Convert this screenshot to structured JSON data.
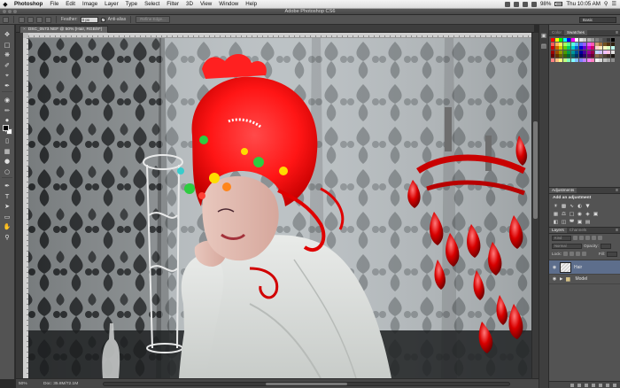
{
  "menubar": {
    "apple_glyph": "",
    "items": [
      "Photoshop",
      "File",
      "Edit",
      "Image",
      "Layer",
      "Type",
      "Select",
      "Filter",
      "3D",
      "View",
      "Window",
      "Help"
    ],
    "battery": "98%",
    "clock": "Thu 10:05 AM"
  },
  "window": {
    "title": "Adobe Photoshop CS6"
  },
  "options": {
    "feather_label": "Feather:",
    "feather_value": "0 px",
    "anti_alias_label": "Anti-alias",
    "refine_label": "Refine Edge...",
    "workspace_value": "Basic"
  },
  "document": {
    "tab_title": "DSC_0573.NEF @ 50% (Hair, RGB/8*)",
    "zoom": "50%",
    "doc_size": "Doc: 35.8M/72.1M"
  },
  "panels": {
    "color_tabs": [
      "Color",
      "Swatches"
    ],
    "swatch_colors": [
      "#ff0000",
      "#ffff00",
      "#00ff00",
      "#00ffff",
      "#0000ff",
      "#ff00ff",
      "#ffffff",
      "#e6e6e6",
      "#cccccc",
      "#b3b3b3",
      "#999999",
      "#808080",
      "#666666",
      "#4d4d4d",
      "#333333",
      "#000000",
      "#ff5a5a",
      "#ffb35a",
      "#fff05a",
      "#a8ff5a",
      "#5aff8d",
      "#5affe0",
      "#5ab8ff",
      "#5a6bff",
      "#9a5aff",
      "#e85aff",
      "#ff5ab0",
      "#c8a070",
      "#a07040",
      "#705020",
      "#503010",
      "#302010",
      "#cc0000",
      "#cc6600",
      "#cccc00",
      "#66cc00",
      "#00cc66",
      "#00cccc",
      "#0066cc",
      "#0000cc",
      "#6600cc",
      "#cc00cc",
      "#cc0066",
      "#ffd0d0",
      "#ffe8c0",
      "#fff8c0",
      "#d8ffc0",
      "#c0fff0",
      "#990000",
      "#994d00",
      "#999900",
      "#4d9900",
      "#00994d",
      "#009999",
      "#004d99",
      "#000099",
      "#4d0099",
      "#990099",
      "#99004d",
      "#c0d8ff",
      "#d0c0ff",
      "#f0c0ff",
      "#ffc0e0",
      "#e0e0e0",
      "#660000",
      "#663300",
      "#666600",
      "#336600",
      "#006633",
      "#006666",
      "#003366",
      "#000066",
      "#330066",
      "#660066",
      "#660033",
      "#8c6d4f",
      "#6f5a45",
      "#4f4035",
      "#3a2f27",
      "#1e1a16",
      "#ff8080",
      "#ffbf80",
      "#ffff80",
      "#bfff80",
      "#80ffbf",
      "#80ffff",
      "#80bfff",
      "#8080ff",
      "#bf80ff",
      "#ff80ff",
      "#ff80bf",
      "#f2f2f2",
      "#d9d9d9",
      "#bfbfbf",
      "#a6a6a6",
      "#8c8c8c"
    ],
    "adjust_tabs": [
      "Adjustments"
    ],
    "adjust_hint": "Add an adjustment",
    "layers_tabs": [
      "Layers",
      "Channels"
    ],
    "kind_label": "Kind",
    "blend_mode": "Normal",
    "opacity_label": "Opacity:",
    "lock_label": "Lock:",
    "fill_label": "Fill:",
    "layers": [
      {
        "name": "Hair"
      },
      {
        "name": "Model"
      }
    ]
  }
}
